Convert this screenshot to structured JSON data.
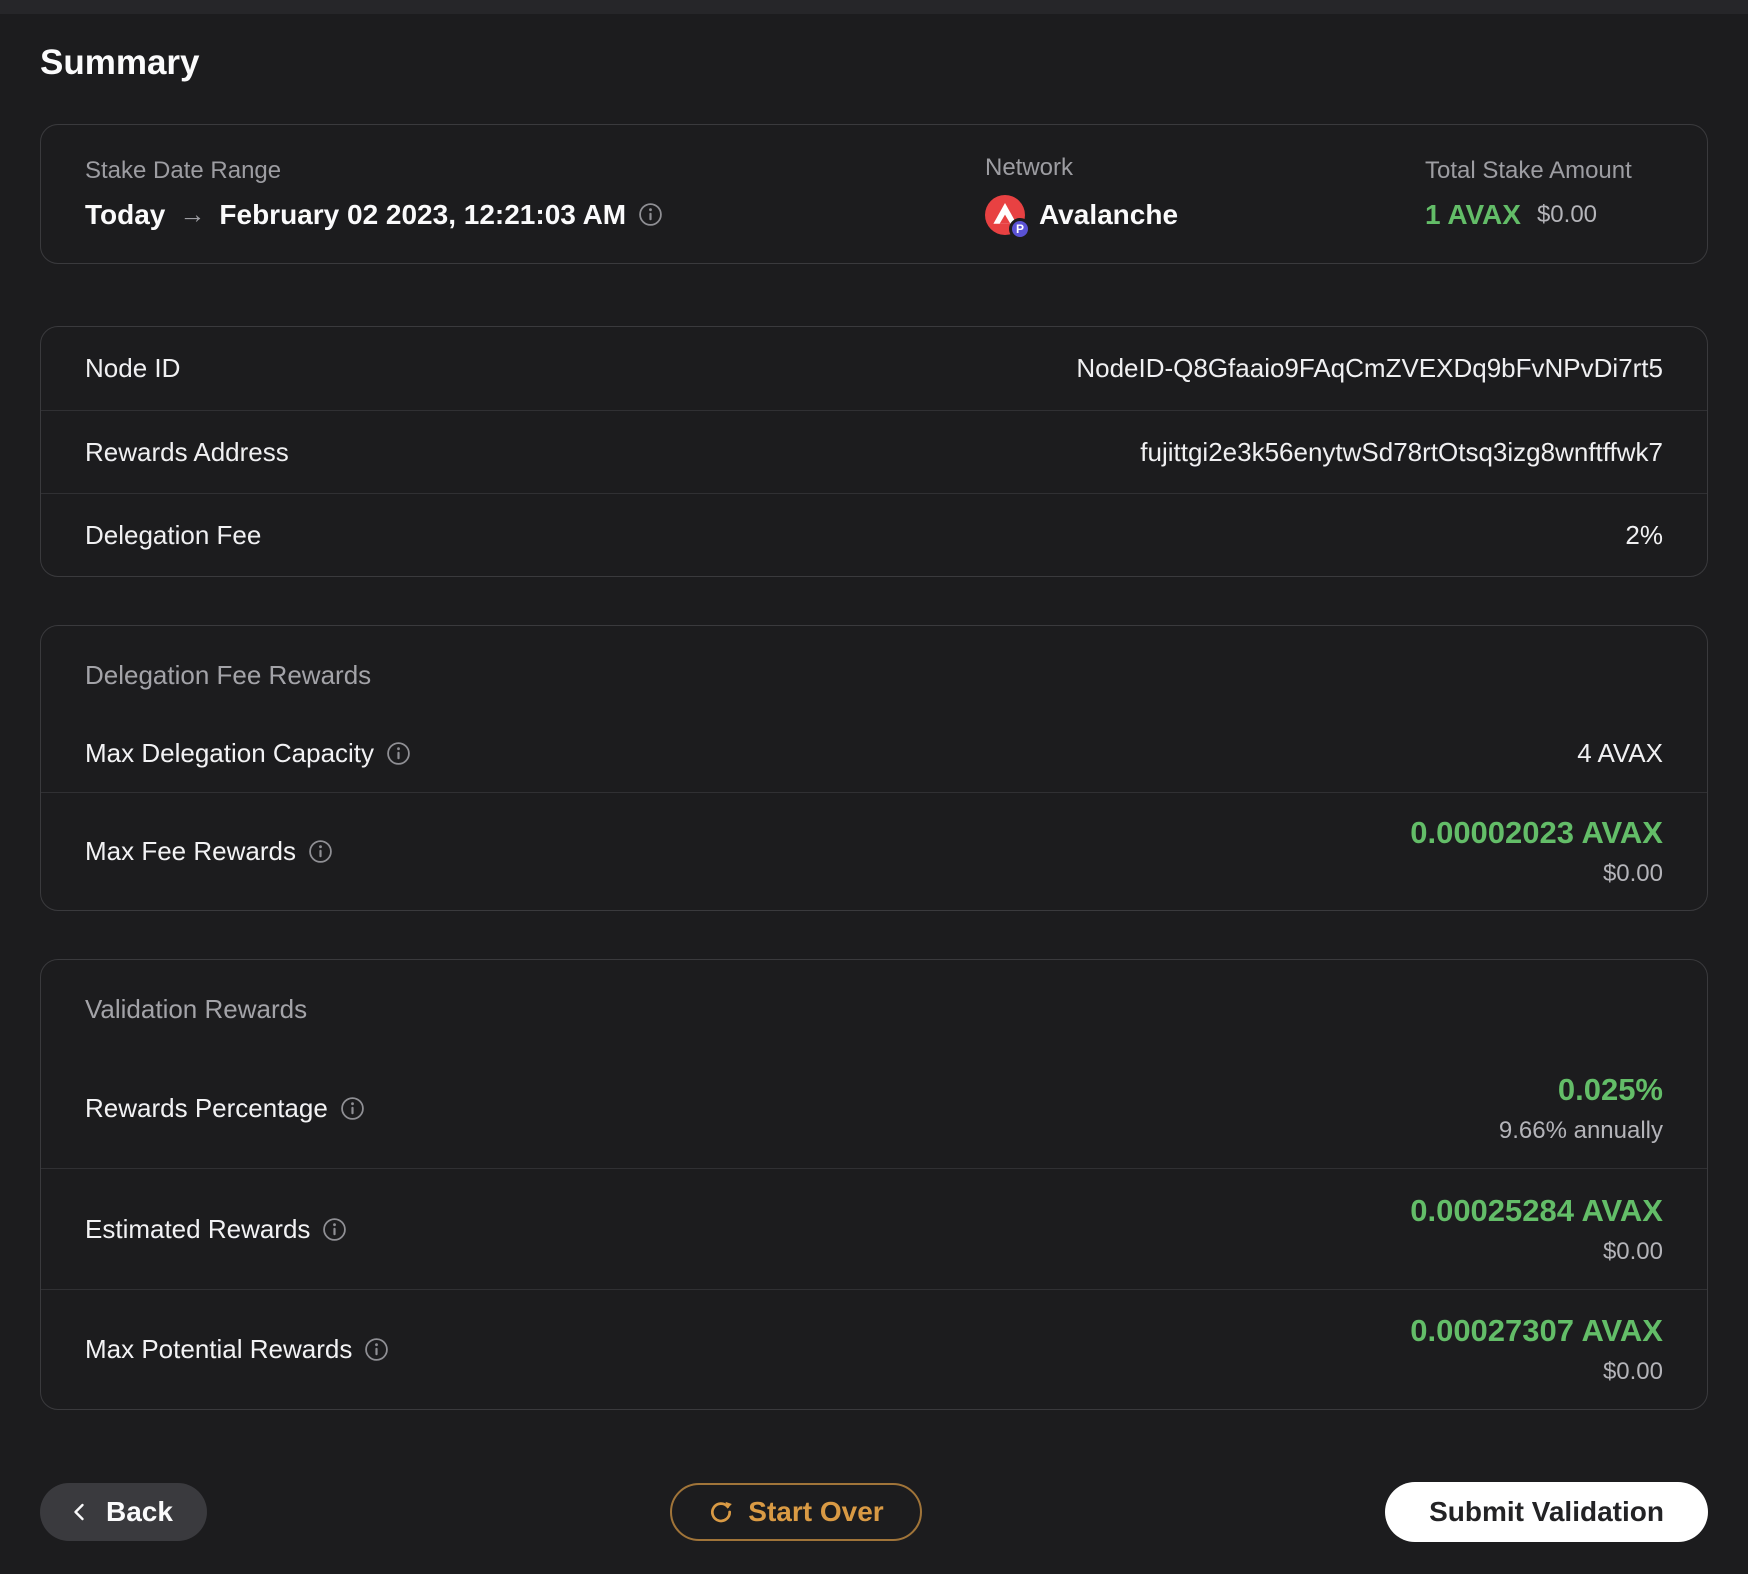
{
  "page": {
    "title": "Summary"
  },
  "overview": {
    "stake_date_range": {
      "label": "Stake Date Range",
      "from": "Today",
      "arrow": "→",
      "to": "February 02 2023, 12:21:03 AM"
    },
    "network": {
      "label": "Network",
      "name": "Avalanche",
      "chain_badge": "P"
    },
    "total_stake": {
      "label": "Total Stake Amount",
      "amount": "1 AVAX",
      "usd": "$0.00"
    }
  },
  "details": {
    "rows": [
      {
        "label": "Node ID",
        "value": "NodeID-Q8Gfaaio9FAqCmZVEXDq9bFvNPvDi7rt5"
      },
      {
        "label": "Rewards Address",
        "value": "fujittgi2e3k56enytwSd78rtOtsq3izg8wnftffwk7"
      },
      {
        "label": "Delegation Fee",
        "value": "2%"
      }
    ]
  },
  "delegation_fee_rewards": {
    "header": "Delegation Fee Rewards",
    "max_delegation_capacity": {
      "label": "Max Delegation Capacity",
      "value": "4 AVAX"
    },
    "max_fee_rewards": {
      "label": "Max Fee Rewards",
      "value": "0.00002023 AVAX",
      "usd": "$0.00"
    }
  },
  "validation_rewards": {
    "header": "Validation Rewards",
    "rewards_percentage": {
      "label": "Rewards Percentage",
      "value": "0.025%",
      "sub": "9.66% annually"
    },
    "estimated_rewards": {
      "label": "Estimated Rewards",
      "value": "0.00025284 AVAX",
      "usd": "$0.00"
    },
    "max_potential_rewards": {
      "label": "Max Potential Rewards",
      "value": "0.00027307 AVAX",
      "usd": "$0.00"
    }
  },
  "footer": {
    "back": "Back",
    "start_over": "Start Over",
    "submit": "Submit Validation"
  },
  "icons": {
    "info": "info-icon",
    "network": "avalanche-p-chain-icon",
    "back": "chevron-left-icon",
    "start_over": "restart-icon",
    "date_arrow": "arrow-right-icon"
  },
  "colors": {
    "accent_green": "#63bd68",
    "accent_orange": "#d99a44",
    "avalanche_red": "#e84142",
    "p_chain_purple": "#5a52d5",
    "submit_bg": "#ffffff",
    "background": "#1c1c1e"
  }
}
